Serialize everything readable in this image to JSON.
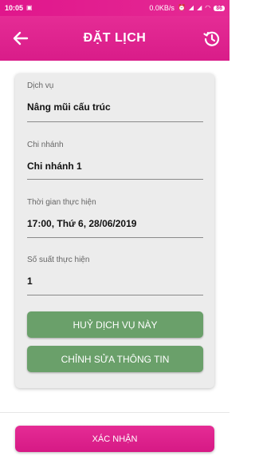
{
  "status_bar": {
    "time": "10:05",
    "network_speed": "0.0KB/s",
    "battery": "86"
  },
  "header": {
    "title": "ĐẶT LỊCH",
    "back_icon": "arrow-left-icon",
    "history_icon": "history-icon"
  },
  "form": {
    "service": {
      "label": "Dịch vụ",
      "value": "Nâng mũi cấu trúc"
    },
    "branch": {
      "label": "Chi nhánh",
      "value": "Chi nhánh 1"
    },
    "time": {
      "label": "Thời gian thực hiện",
      "value": "17:00, Thứ 6, 28/06/2019"
    },
    "slots": {
      "label": "Số suất thực hiện",
      "value": "1"
    }
  },
  "actions": {
    "cancel_service": "HUỶ DỊCH VỤ NÀY",
    "edit_info": "CHỈNH SỬA THÔNG TIN",
    "confirm": "XÁC NHẬN"
  },
  "colors": {
    "primary": "#e0168c",
    "action_green": "#6aa06a",
    "card_bg": "#ececec"
  }
}
